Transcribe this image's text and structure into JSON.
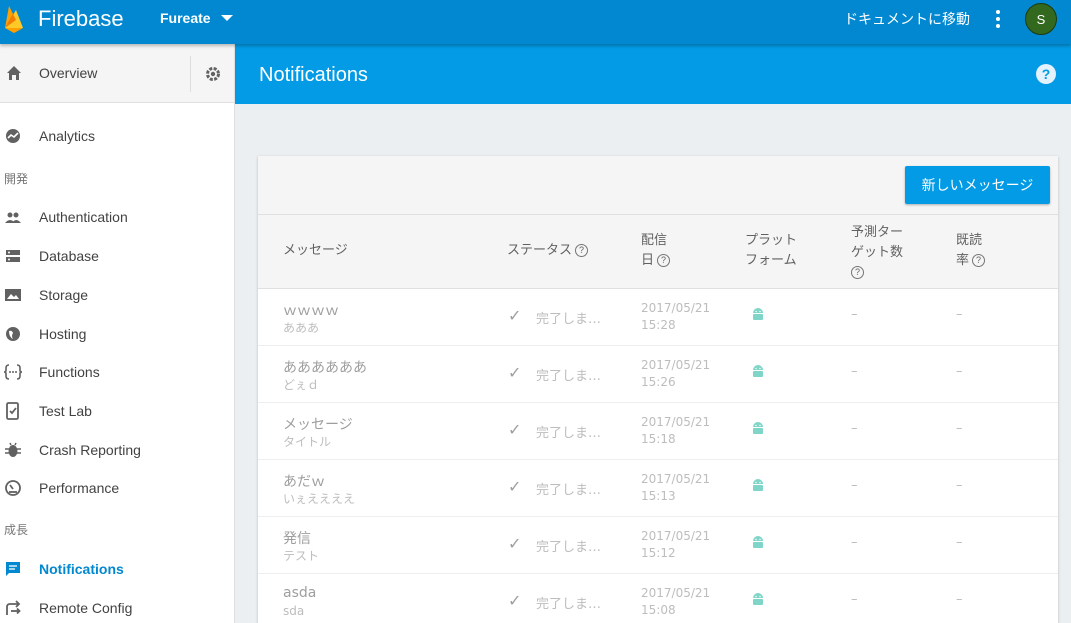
{
  "topbar": {
    "brand": "Firebase",
    "project": "Fureate",
    "docs_link": "ドキュメントに移動",
    "avatar_letter": "S"
  },
  "sidebar": {
    "overview": "Overview",
    "sections": {
      "develop": "開発",
      "grow": "成長"
    },
    "items": [
      {
        "label": "Analytics",
        "icon": "analytics-icon"
      },
      {
        "label": "Authentication",
        "icon": "people-icon"
      },
      {
        "label": "Database",
        "icon": "database-icon"
      },
      {
        "label": "Storage",
        "icon": "storage-icon"
      },
      {
        "label": "Hosting",
        "icon": "globe-icon"
      },
      {
        "label": "Functions",
        "icon": "functions-icon"
      },
      {
        "label": "Test Lab",
        "icon": "test-lab-icon"
      },
      {
        "label": "Crash Reporting",
        "icon": "bug-icon"
      },
      {
        "label": "Performance",
        "icon": "speedometer-icon"
      },
      {
        "label": "Notifications",
        "icon": "chat-icon",
        "active": true
      },
      {
        "label": "Remote Config",
        "icon": "remote-config-icon"
      }
    ]
  },
  "header": {
    "title": "Notifications"
  },
  "card": {
    "new_message_button": "新しいメッセージ",
    "columns": {
      "message": "メッセージ",
      "status": "ステータス",
      "delivery_1": "配信",
      "delivery_2": "日",
      "platform_1": "プラット",
      "platform_2": "フォーム",
      "prediction_1": "予測ター",
      "prediction_2": "ゲット数",
      "read_1": "既読",
      "read_2": "率"
    },
    "rows": [
      {
        "title": "ｗｗｗｗ",
        "subtitle": "あああ",
        "status": "完了しま…",
        "date": "2017/05/21",
        "time": "15:28",
        "prediction": "–",
        "read": "–"
      },
      {
        "title": "ああああああ",
        "subtitle": "どぇｄ",
        "status": "完了しま…",
        "date": "2017/05/21",
        "time": "15:26",
        "prediction": "–",
        "read": "–"
      },
      {
        "title": "メッセージ",
        "subtitle": "タイトル",
        "status": "完了しま…",
        "date": "2017/05/21",
        "time": "15:18",
        "prediction": "–",
        "read": "–"
      },
      {
        "title": "あだｗ",
        "subtitle": "いぇええええ",
        "status": "完了しま…",
        "date": "2017/05/21",
        "time": "15:13",
        "prediction": "–",
        "read": "–"
      },
      {
        "title": "発信",
        "subtitle": "テスト",
        "status": "完了しま…",
        "date": "2017/05/21",
        "time": "15:12",
        "prediction": "–",
        "read": "–"
      },
      {
        "title": "asda",
        "subtitle": "sda",
        "status": "完了しま…",
        "date": "2017/05/21",
        "time": "15:08",
        "prediction": "–",
        "read": "–"
      }
    ]
  },
  "colors": {
    "topbar": "#0288d1",
    "header": "#039be5",
    "accent": "#039be5",
    "android": "#7fd6c8"
  }
}
